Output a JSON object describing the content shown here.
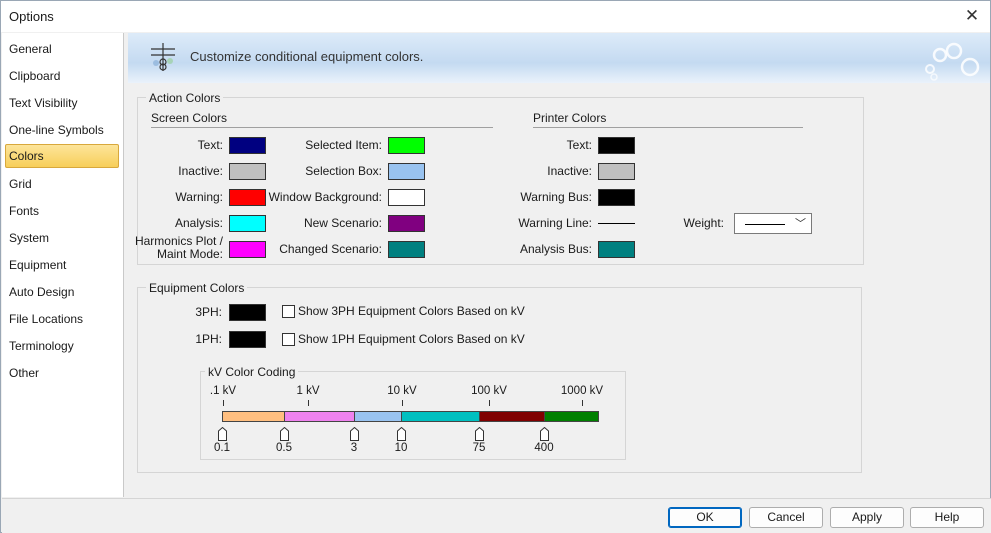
{
  "window": {
    "title": "Options"
  },
  "sidebar": {
    "items": [
      {
        "label": "General"
      },
      {
        "label": "Clipboard"
      },
      {
        "label": "Text Visibility"
      },
      {
        "label": "One-line Symbols"
      },
      {
        "label": "Colors",
        "selected": true
      },
      {
        "label": "Grid"
      },
      {
        "label": "Fonts"
      },
      {
        "label": "System"
      },
      {
        "label": "Equipment"
      },
      {
        "label": "Auto Design"
      },
      {
        "label": "File Locations"
      },
      {
        "label": "Terminology"
      },
      {
        "label": "Other"
      }
    ]
  },
  "banner": {
    "text": "Customize conditional equipment colors."
  },
  "action_colors": {
    "title": "Action Colors",
    "screen": {
      "title": "Screen Colors",
      "left": [
        {
          "label": "Text:",
          "color": "#000080"
        },
        {
          "label": "Inactive:",
          "color": "#c0c0c0"
        },
        {
          "label": "Warning:",
          "color": "#ff0000"
        },
        {
          "label": "Analysis:",
          "color": "#00ffff"
        },
        {
          "label_line1": "Harmonics Plot /",
          "label_line2": "Maint Mode:",
          "color": "#ff00ff"
        }
      ],
      "right": [
        {
          "label": "Selected Item:",
          "color": "#00ff00"
        },
        {
          "label": "Selection Box:",
          "color": "#99c3f0"
        },
        {
          "label": "Window Background:",
          "color": "#ffffff"
        },
        {
          "label": "New Scenario:",
          "color": "#800080"
        },
        {
          "label": "Changed Scenario:",
          "color": "#008080"
        }
      ]
    },
    "printer": {
      "title": "Printer Colors",
      "items": [
        {
          "label": "Text:",
          "color": "#000000"
        },
        {
          "label": "Inactive:",
          "color": "#c0c0c0"
        },
        {
          "label": "Warning Bus:",
          "color": "#000000"
        },
        {
          "label": "Warning Line:",
          "line": true
        },
        {
          "label": "Analysis Bus:",
          "color": "#008080"
        }
      ],
      "weight_label": "Weight:"
    }
  },
  "equipment_colors": {
    "title": "Equipment Colors",
    "rows": [
      {
        "label": "3PH:",
        "color": "#000000",
        "checkbox_label": "Show 3PH Equipment Colors Based on kV",
        "checked": false
      },
      {
        "label": "1PH:",
        "color": "#000000",
        "checkbox_label": "Show 1PH Equipment Colors Based on kV",
        "checked": false
      }
    ],
    "kv": {
      "title": "kV Color Coding",
      "scale_labels": [
        ".1 kV",
        "1 kV",
        "10 kV",
        "100 kV",
        "1000 kV"
      ],
      "segments": [
        {
          "color": "#ffbf80"
        },
        {
          "color": "#ee82ee"
        },
        {
          "color": "#99c3f0"
        },
        {
          "color": "#00c0c0"
        },
        {
          "color": "#800000"
        },
        {
          "color": "#008000"
        }
      ],
      "thresholds": [
        "0.1",
        "0.5",
        "3",
        "10",
        "75",
        "400"
      ]
    }
  },
  "footer": {
    "ok": "OK",
    "cancel": "Cancel",
    "apply": "Apply",
    "help": "Help"
  }
}
